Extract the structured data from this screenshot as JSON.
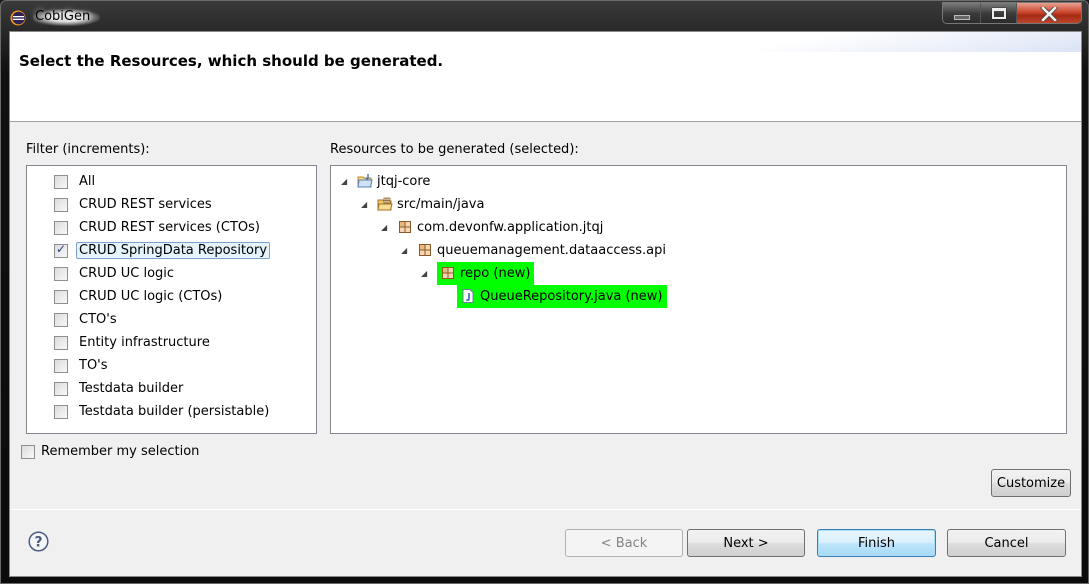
{
  "window": {
    "title": "CobiGen",
    "controls": {
      "minimize": "minimize-icon",
      "maximize": "maximize-icon",
      "close": "close-icon"
    }
  },
  "header": {
    "title": "Select the Resources, which should be generated."
  },
  "filter": {
    "label": "Filter (increments):",
    "items": [
      {
        "label": "All",
        "checked": false,
        "selected": false
      },
      {
        "label": "CRUD REST services",
        "checked": false,
        "selected": false
      },
      {
        "label": "CRUD REST services (CTOs)",
        "checked": false,
        "selected": false
      },
      {
        "label": "CRUD SpringData Repository",
        "checked": true,
        "selected": true
      },
      {
        "label": "CRUD UC logic",
        "checked": false,
        "selected": false
      },
      {
        "label": "CRUD UC logic (CTOs)",
        "checked": false,
        "selected": false
      },
      {
        "label": "CTO's",
        "checked": false,
        "selected": false
      },
      {
        "label": "Entity infrastructure",
        "checked": false,
        "selected": false
      },
      {
        "label": "TO's",
        "checked": false,
        "selected": false
      },
      {
        "label": "Testdata builder",
        "checked": false,
        "selected": false
      },
      {
        "label": "Testdata builder (persistable)",
        "checked": false,
        "selected": false
      }
    ]
  },
  "resources": {
    "label": "Resources to be generated (selected):",
    "highlight_color": "#00ff00",
    "tree": [
      {
        "label": "jtqj-core",
        "icon": "project-folder-icon",
        "level": 0,
        "expanded": true,
        "highlighted": false
      },
      {
        "label": "src/main/java",
        "icon": "source-folder-icon",
        "level": 1,
        "expanded": true,
        "highlighted": false
      },
      {
        "label": "com.devonfw.application.jtqj",
        "icon": "package-icon",
        "level": 2,
        "expanded": true,
        "highlighted": false
      },
      {
        "label": "queuemanagement.dataaccess.api",
        "icon": "package-icon",
        "level": 3,
        "expanded": true,
        "highlighted": false
      },
      {
        "label": "repo (new)",
        "icon": "package-icon",
        "level": 4,
        "expanded": true,
        "highlighted": true
      },
      {
        "label": "QueueRepository.java (new)",
        "icon": "java-file-icon",
        "level": 5,
        "expanded": null,
        "highlighted": true
      }
    ]
  },
  "remember": {
    "label": "Remember my selection",
    "checked": false
  },
  "buttons": {
    "customize": "Customize",
    "back": "< Back",
    "next": "Next >",
    "finish": "Finish",
    "cancel": "Cancel"
  }
}
